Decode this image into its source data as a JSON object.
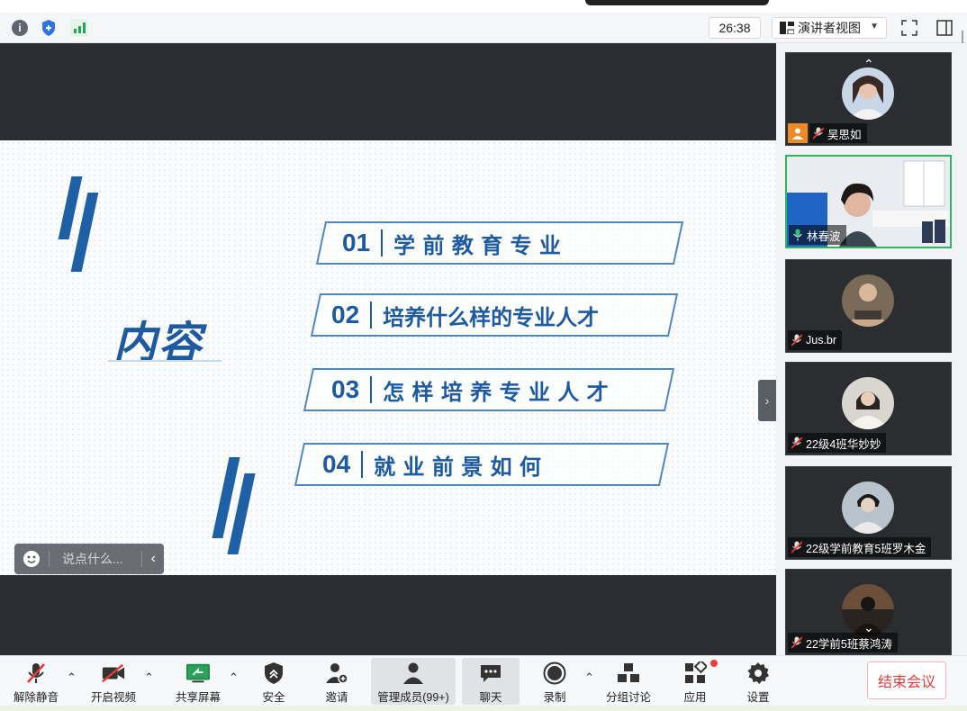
{
  "window": {
    "timer": "26:38",
    "view_label": "演讲者视图"
  },
  "slide": {
    "title": "内容",
    "items": [
      {
        "num": "01",
        "text": "学 前 教 育 专 业"
      },
      {
        "num": "02",
        "text": "培养什么样的专业人才"
      },
      {
        "num": "03",
        "text": "怎 样 培 养 专 业 人 才"
      },
      {
        "num": "04",
        "text": "就  业  前  景  如  何"
      }
    ]
  },
  "comment": {
    "placeholder": "说点什么..."
  },
  "participants": [
    {
      "name": "吴思如",
      "mic": "muted",
      "host": true
    },
    {
      "name": "林春波",
      "mic": "active",
      "host": false
    },
    {
      "name": "Jus.br",
      "mic": "muted",
      "host": false
    },
    {
      "name": "22级4班华妙妙",
      "mic": "muted",
      "host": false
    },
    {
      "name": "22级学前教育5班罗木金",
      "mic": "muted",
      "host": false
    },
    {
      "name": "22学前5班蔡鸿涛",
      "mic": "muted",
      "host": false
    }
  ],
  "toolbar": {
    "unmute": "解除静音",
    "start_video": "开启视频",
    "share_screen": "共享屏幕",
    "security": "安全",
    "invite": "邀请",
    "manage_members": "管理成员(99+)",
    "chat": "聊天",
    "record": "录制",
    "breakout": "分组讨论",
    "apps": "应用",
    "settings": "设置",
    "end_meeting": "结束会议"
  },
  "colors": {
    "slide_blue": "#1d5aa0",
    "end_red": "#e03a3a",
    "active_green": "#2fb65c",
    "host_orange": "#f08a24"
  }
}
